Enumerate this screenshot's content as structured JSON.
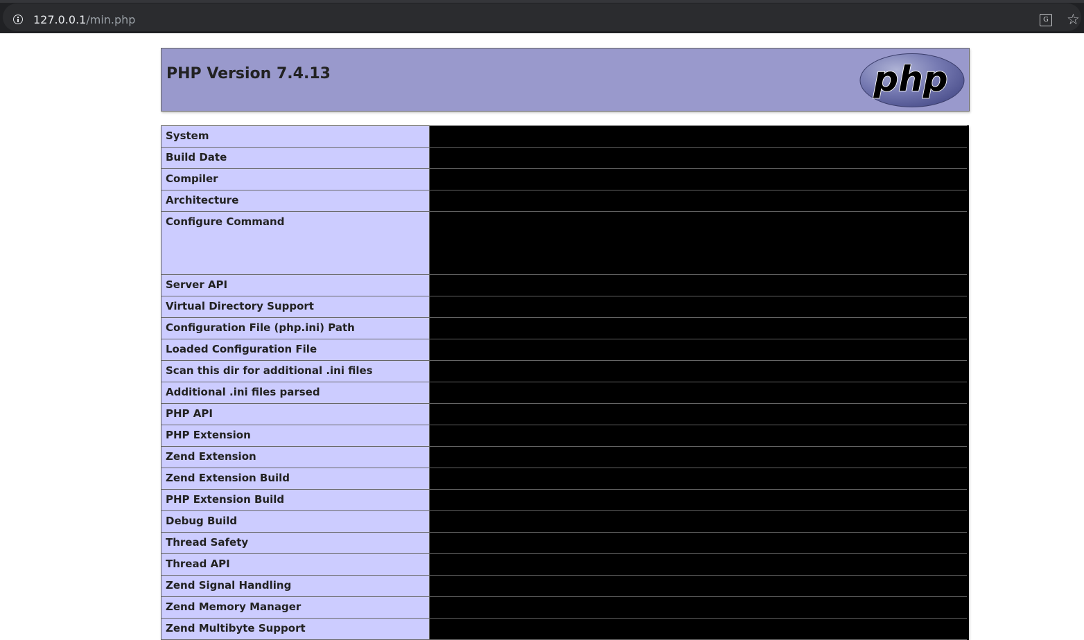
{
  "browser": {
    "url_host": "127.0.0.1",
    "url_path": "/min.php",
    "icons": [
      "info-icon",
      "translate-icon",
      "star-icon"
    ]
  },
  "header": {
    "title": "PHP Version 7.4.13",
    "logo_text": "php"
  },
  "colors": {
    "header_bg": "#9999cc",
    "key_cell_bg": "#ccccff",
    "value_cell_bg": "#000000",
    "browser_bg": "#202124"
  },
  "rows": [
    {
      "label": "System"
    },
    {
      "label": "Build Date"
    },
    {
      "label": "Compiler"
    },
    {
      "label": "Architecture"
    },
    {
      "label": "Configure Command"
    },
    {
      "label": "Server API"
    },
    {
      "label": "Virtual Directory Support"
    },
    {
      "label": "Configuration File (php.ini) Path"
    },
    {
      "label": "Loaded Configuration File"
    },
    {
      "label": "Scan this dir for additional .ini files"
    },
    {
      "label": "Additional .ini files parsed"
    },
    {
      "label": "PHP API"
    },
    {
      "label": "PHP Extension"
    },
    {
      "label": "Zend Extension"
    },
    {
      "label": "Zend Extension Build"
    },
    {
      "label": "PHP Extension Build"
    },
    {
      "label": "Debug Build"
    },
    {
      "label": "Thread Safety"
    },
    {
      "label": "Thread API"
    },
    {
      "label": "Zend Signal Handling"
    },
    {
      "label": "Zend Memory Manager"
    },
    {
      "label": "Zend Multibyte Support"
    }
  ]
}
